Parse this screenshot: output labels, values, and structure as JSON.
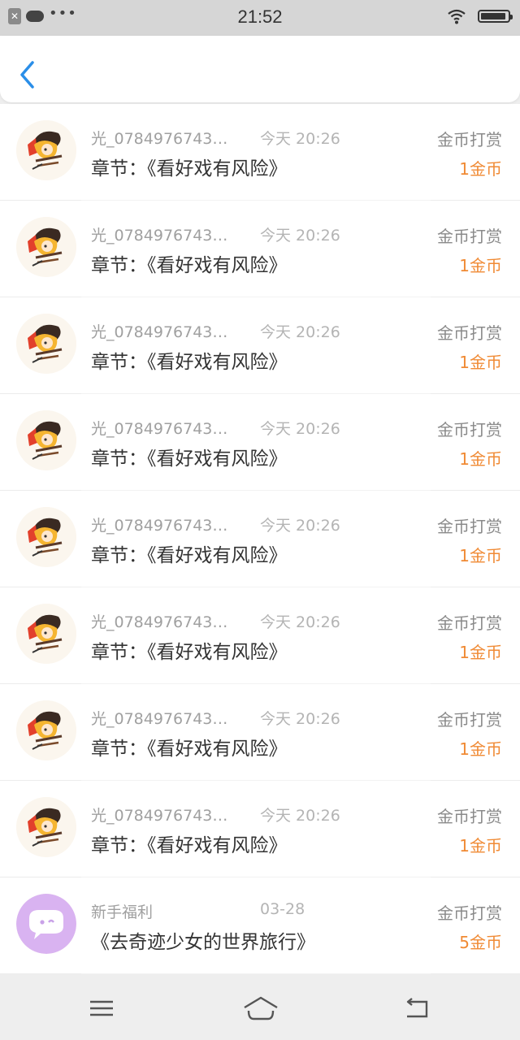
{
  "status_bar": {
    "time": "21:52",
    "left_icons": [
      "close-icon",
      "cloud-icon",
      "more-dots-icon"
    ],
    "right_icons": [
      "wifi-icon",
      "battery-icon"
    ]
  },
  "nav": {
    "back_icon": "chevron-left-icon"
  },
  "colors": {
    "accent": "#2a8ee8",
    "amount": "#f08a34",
    "welfare_avatar": "#d9b3f1"
  },
  "rewards": [
    {
      "name": "光_0784976743…",
      "time": "今天 20:26",
      "title": "章节：《看好戏有风险》",
      "type": "金币打赏",
      "amount": "1金币"
    },
    {
      "name": "光_0784976743…",
      "time": "今天 20:26",
      "title": "章节：《看好戏有风险》",
      "type": "金币打赏",
      "amount": "1金币"
    },
    {
      "name": "光_0784976743…",
      "time": "今天 20:26",
      "title": "章节：《看好戏有风险》",
      "type": "金币打赏",
      "amount": "1金币"
    },
    {
      "name": "光_0784976743…",
      "time": "今天 20:26",
      "title": "章节：《看好戏有风险》",
      "type": "金币打赏",
      "amount": "1金币"
    },
    {
      "name": "光_0784976743…",
      "time": "今天 20:26",
      "title": "章节：《看好戏有风险》",
      "type": "金币打赏",
      "amount": "1金币"
    },
    {
      "name": "光_0784976743…",
      "time": "今天 20:26",
      "title": "章节：《看好戏有风险》",
      "type": "金币打赏",
      "amount": "1金币"
    },
    {
      "name": "光_0784976743…",
      "time": "今天 20:26",
      "title": "章节：《看好戏有风险》",
      "type": "金币打赏",
      "amount": "1金币"
    },
    {
      "name": "光_0784976743…",
      "time": "今天 20:26",
      "title": "章节：《看好戏有风险》",
      "type": "金币打赏",
      "amount": "1金币"
    },
    {
      "name": "新手福利",
      "time": "03-28",
      "title": "《去奇迹少女的世界旅行》",
      "type": "金币打赏",
      "amount": "5金币"
    }
  ],
  "bottom_bar": {
    "icons": [
      "menu-icon",
      "home-icon",
      "back-arrow-icon"
    ]
  }
}
